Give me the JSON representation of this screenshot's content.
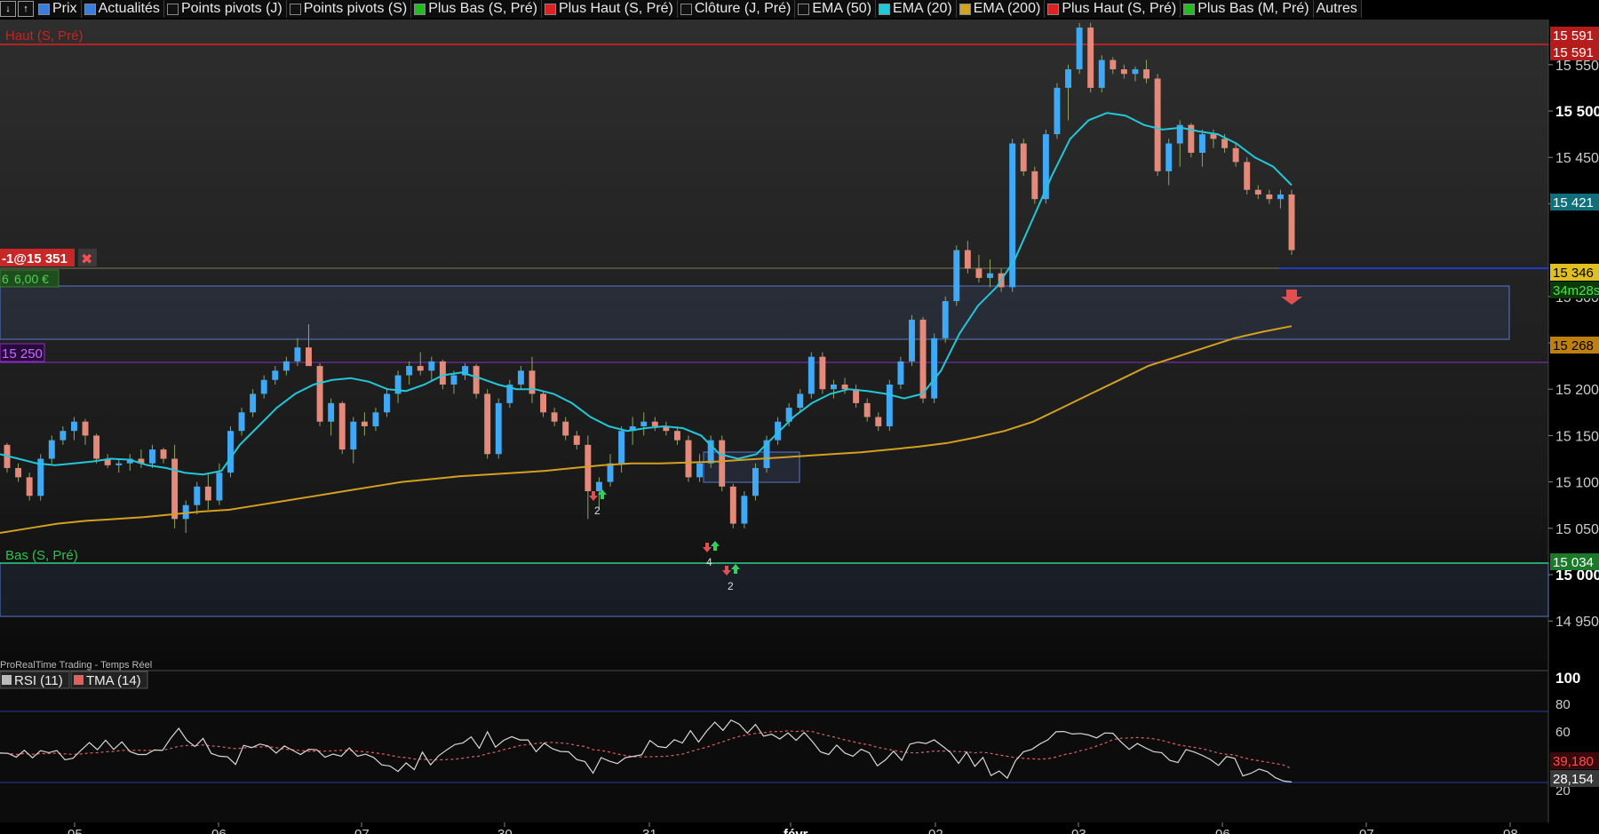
{
  "toolbar": {
    "items": [
      {
        "label": "Prix",
        "color": "#3b7ddd"
      },
      {
        "label": "Actualités",
        "color": "#3b7ddd"
      },
      {
        "label": "Points pivots (J)",
        "color": "#111111"
      },
      {
        "label": "Points pivots (S)",
        "color": "#111111"
      },
      {
        "label": "Plus Bas (S, Pré)",
        "color": "#22bb22"
      },
      {
        "label": "Plus Haut (S, Pré)",
        "color": "#dd2222"
      },
      {
        "label": "Clôture (J, Pré)",
        "color": "#111111"
      },
      {
        "label": "EMA (50)",
        "color": "#111111"
      },
      {
        "label": "EMA (20)",
        "color": "#22c8d8"
      },
      {
        "label": "EMA (200)",
        "color": "#d4a020"
      },
      {
        "label": "Plus Haut (S, Pré)",
        "color": "#dd2222"
      },
      {
        "label": "Plus Bas (M, Pré)",
        "color": "#22bb22"
      },
      {
        "label": "Autres",
        "color": ""
      }
    ]
  },
  "main_labels": {
    "haut": "Haut (S, Pré)",
    "bas": "Bas (S, Pré)",
    "order": "-1@15 351",
    "close_x": "✖",
    "pnl_left": "6",
    "pnl": "6,00 €",
    "level_15250": "15 250",
    "footer_caption": "ProRealTime Trading - Temps Réel"
  },
  "price_axis": {
    "ticks": [
      "15 550",
      "15 500",
      "15 450",
      "15 400",
      "15 300",
      "15 250",
      "15 200",
      "15 150",
      "15 100",
      "15 050",
      "15 000",
      "14 950"
    ],
    "bold_ticks": [
      "15 500",
      "15 000"
    ],
    "tags": {
      "high1": "15 591",
      "high2": "15 591",
      "ema20": "15 421",
      "last": "15 346",
      "timer": "34m28s",
      "ema200": "15 268",
      "low": "15 034"
    }
  },
  "rsi_panel": {
    "legend": [
      {
        "label": "RSI (11)",
        "color": "#bbbbbb"
      },
      {
        "label": "TMA (14)",
        "color": "#e06060"
      }
    ],
    "ticks": [
      "100",
      "80",
      "60",
      "20"
    ],
    "tags": {
      "tma": "39,180",
      "rsi": "28,154"
    }
  },
  "date_axis": {
    "labels": [
      "05",
      "06",
      "07",
      "30",
      "31",
      "févr.",
      "02",
      "03",
      "06",
      "07",
      "08"
    ]
  },
  "signals": [
    "2",
    "4",
    "2"
  ],
  "colors": {
    "bull": "#3fa9f5",
    "bear": "#e58a7a",
    "ema20": "#22c8d8",
    "ema200": "#d4a020",
    "high_line": "#e02020",
    "low_line": "#30d080",
    "last_line": "#2040ff",
    "zone": "#5a78c8",
    "purple": "#8a30c0"
  },
  "chart_data": {
    "type": "candlestick",
    "ylim": [
      14930,
      15610
    ],
    "candles_ohlc": [
      [
        15140,
        15142,
        15110,
        15115
      ],
      [
        15115,
        15120,
        15100,
        15105
      ],
      [
        15105,
        15110,
        15080,
        15085
      ],
      [
        15085,
        15130,
        15080,
        15125
      ],
      [
        15125,
        15150,
        15120,
        15145
      ],
      [
        15145,
        15160,
        15140,
        15155
      ],
      [
        15155,
        15170,
        15145,
        15165
      ],
      [
        15165,
        15168,
        15140,
        15150
      ],
      [
        15150,
        15152,
        15120,
        15125
      ],
      [
        15125,
        15130,
        15115,
        15118
      ],
      [
        15118,
        15125,
        15110,
        15120
      ],
      [
        15120,
        15130,
        15112,
        15125
      ],
      [
        15125,
        15135,
        15115,
        15120
      ],
      [
        15120,
        15140,
        15115,
        15135
      ],
      [
        15135,
        15137,
        15120,
        15125
      ],
      [
        15125,
        15140,
        15050,
        15060
      ],
      [
        15060,
        15080,
        15045,
        15075
      ],
      [
        15075,
        15100,
        15065,
        15095
      ],
      [
        15095,
        15110,
        15070,
        15080
      ],
      [
        15080,
        15120,
        15075,
        15110
      ],
      [
        15110,
        15160,
        15105,
        15155
      ],
      [
        15155,
        15180,
        15150,
        15175
      ],
      [
        15175,
        15200,
        15170,
        15195
      ],
      [
        15195,
        15215,
        15190,
        15210
      ],
      [
        15210,
        15225,
        15205,
        15220
      ],
      [
        15220,
        15235,
        15215,
        15230
      ],
      [
        15230,
        15255,
        15225,
        15245
      ],
      [
        15245,
        15270,
        15235,
        15225
      ],
      [
        15225,
        15228,
        15160,
        15165
      ],
      [
        15165,
        15190,
        15150,
        15185
      ],
      [
        15185,
        15187,
        15130,
        15135
      ],
      [
        15135,
        15170,
        15120,
        15165
      ],
      [
        15165,
        15175,
        15150,
        15160
      ],
      [
        15160,
        15180,
        15155,
        15175
      ],
      [
        15175,
        15200,
        15170,
        15195
      ],
      [
        15195,
        15220,
        15185,
        15215
      ],
      [
        15215,
        15230,
        15205,
        15225
      ],
      [
        15225,
        15240,
        15215,
        15220
      ],
      [
        15220,
        15235,
        15210,
        15230
      ],
      [
        15230,
        15232,
        15200,
        15205
      ],
      [
        15205,
        15220,
        15195,
        15215
      ],
      [
        15215,
        15228,
        15210,
        15225
      ],
      [
        15225,
        15227,
        15190,
        15195
      ],
      [
        15195,
        15200,
        15125,
        15130
      ],
      [
        15130,
        15190,
        15125,
        15185
      ],
      [
        15185,
        15210,
        15180,
        15205
      ],
      [
        15205,
        15225,
        15200,
        15220
      ],
      [
        15220,
        15235,
        15185,
        15195
      ],
      [
        15195,
        15197,
        15170,
        15175
      ],
      [
        15175,
        15180,
        15160,
        15165
      ],
      [
        15165,
        15170,
        15145,
        15150
      ],
      [
        15150,
        15155,
        15135,
        15140
      ],
      [
        15140,
        15150,
        15060,
        15090
      ],
      [
        15090,
        15105,
        15070,
        15100
      ],
      [
        15100,
        15130,
        15095,
        15120
      ],
      [
        15120,
        15160,
        15110,
        15155
      ],
      [
        15155,
        15170,
        15140,
        15160
      ],
      [
        15160,
        15175,
        15150,
        15165
      ],
      [
        15165,
        15170,
        15155,
        15160
      ],
      [
        15160,
        15165,
        15150,
        15155
      ],
      [
        15155,
        15160,
        15140,
        15145
      ],
      [
        15145,
        15150,
        15100,
        15105
      ],
      [
        15105,
        15130,
        15100,
        15120
      ],
      [
        15120,
        15150,
        15115,
        15145
      ],
      [
        15145,
        15150,
        15090,
        15095
      ],
      [
        15095,
        15098,
        15050,
        15055
      ],
      [
        15055,
        15090,
        15050,
        15085
      ],
      [
        15085,
        15120,
        15080,
        15115
      ],
      [
        15115,
        15150,
        15110,
        15145
      ],
      [
        15145,
        15170,
        15140,
        15165
      ],
      [
        15165,
        15185,
        15160,
        15180
      ],
      [
        15180,
        15200,
        15175,
        15195
      ],
      [
        15195,
        15240,
        15190,
        15235
      ],
      [
        15235,
        15240,
        15195,
        15200
      ],
      [
        15200,
        15210,
        15190,
        15205
      ],
      [
        15205,
        15212,
        15195,
        15200
      ],
      [
        15200,
        15205,
        15180,
        15185
      ],
      [
        15185,
        15190,
        15165,
        15170
      ],
      [
        15170,
        15175,
        15155,
        15160
      ],
      [
        15160,
        15210,
        15155,
        15205
      ],
      [
        15205,
        15235,
        15200,
        15230
      ],
      [
        15230,
        15280,
        15225,
        15275
      ],
      [
        15275,
        15278,
        15185,
        15190
      ],
      [
        15190,
        15260,
        15185,
        15255
      ],
      [
        15255,
        15300,
        15250,
        15295
      ],
      [
        15295,
        15355,
        15290,
        15350
      ],
      [
        15350,
        15360,
        15325,
        15330
      ],
      [
        15330,
        15345,
        15315,
        15320
      ],
      [
        15320,
        15340,
        15310,
        15325
      ],
      [
        15325,
        15330,
        15305,
        15310
      ],
      [
        15310,
        15470,
        15305,
        15465
      ],
      [
        15465,
        15470,
        15430,
        15435
      ],
      [
        15435,
        15440,
        15400,
        15405
      ],
      [
        15405,
        15480,
        15400,
        15475
      ],
      [
        15475,
        15530,
        15470,
        15525
      ],
      [
        15525,
        15550,
        15490,
        15545
      ],
      [
        15545,
        15595,
        15540,
        15590
      ],
      [
        15590,
        15595,
        15520,
        15525
      ],
      [
        15525,
        15560,
        15520,
        15555
      ],
      [
        15555,
        15558,
        15540,
        15545
      ],
      [
        15545,
        15550,
        15535,
        15540
      ],
      [
        15540,
        15548,
        15532,
        15545
      ],
      [
        15545,
        15555,
        15530,
        15535
      ],
      [
        15535,
        15540,
        15430,
        15435
      ],
      [
        15435,
        15470,
        15420,
        15465
      ],
      [
        15465,
        15490,
        15440,
        15485
      ],
      [
        15485,
        15487,
        15450,
        15455
      ],
      [
        15455,
        15480,
        15440,
        15475
      ],
      [
        15475,
        15480,
        15460,
        15470
      ],
      [
        15470,
        15475,
        15455,
        15460
      ],
      [
        15460,
        15465,
        15440,
        15445
      ],
      [
        15445,
        15450,
        15410,
        15415
      ],
      [
        15415,
        15420,
        15405,
        15410
      ],
      [
        15410,
        15415,
        15400,
        15405
      ],
      [
        15405,
        15415,
        15395,
        15410
      ],
      [
        15410,
        15415,
        15345,
        15350
      ]
    ],
    "ema20": [
      15130,
      15125,
      15120,
      15118,
      15120,
      15122,
      15125,
      15124,
      15118,
      15115,
      15110,
      15108,
      15112,
      15140,
      15160,
      15180,
      15195,
      15205,
      15210,
      15212,
      15208,
      15200,
      15198,
      15205,
      15215,
      15218,
      15212,
      15205,
      15200,
      15200,
      15195,
      15185,
      15170,
      15160,
      15155,
      15158,
      15160,
      15158,
      15150,
      15130,
      15125,
      15130,
      15150,
      15170,
      15185,
      15195,
      15200,
      15198,
      15195,
      15190,
      15195,
      15220,
      15260,
      15290,
      15310,
      15340,
      15385,
      15430,
      15470,
      15490,
      15498,
      15495,
      15485,
      15480,
      15482,
      15478,
      15475,
      15465,
      15450,
      15440,
      15420
    ],
    "ema200": [
      15045,
      15050,
      15055,
      15058,
      15060,
      15062,
      15065,
      15068,
      15070,
      15075,
      15080,
      15085,
      15090,
      15095,
      15100,
      15103,
      15106,
      15108,
      15110,
      15112,
      15115,
      15118,
      15120,
      15120,
      15121,
      15122,
      15124,
      15126,
      15128,
      15130,
      15132,
      15135,
      15138,
      15142,
      15148,
      15155,
      15165,
      15180,
      15195,
      15210,
      15225,
      15235,
      15245,
      15255,
      15262,
      15268
    ],
    "rsi_range": [
      0,
      100
    ],
    "rsi_tma_last": 39.18,
    "rsi_last": 28.154
  }
}
